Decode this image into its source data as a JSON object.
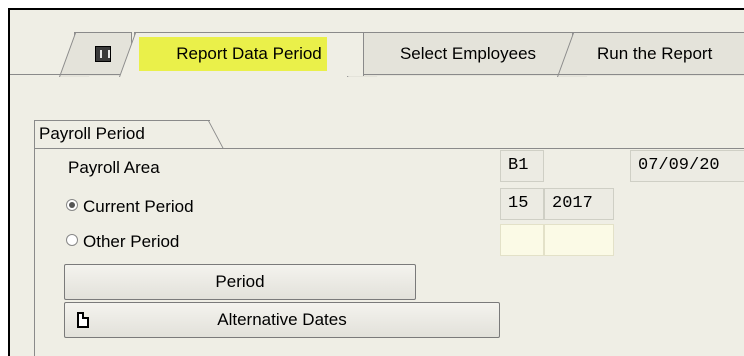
{
  "tabs": [
    {
      "label": "",
      "icon": "info-icon"
    },
    {
      "label": "Report Data Period",
      "active": true,
      "highlight": "#eaf04a"
    },
    {
      "label": "Select Employees"
    },
    {
      "label": "Run the Report"
    }
  ],
  "group": {
    "title": "Payroll Period",
    "payroll_area": {
      "label": "Payroll Area",
      "value": "B1",
      "date": "07/09/20"
    },
    "current_period": {
      "label": "Current Period",
      "selected": true,
      "period": "15",
      "year": "2017"
    },
    "other_period": {
      "label": "Other Period",
      "selected": false,
      "period": "",
      "year": ""
    },
    "buttons": {
      "period": "Period",
      "alternative_dates": "Alternative Dates"
    }
  }
}
